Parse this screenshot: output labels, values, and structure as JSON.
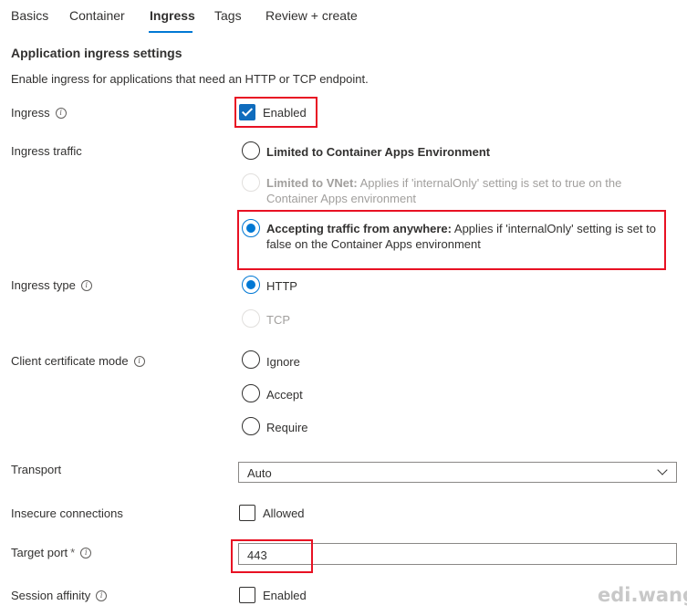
{
  "tabs": [
    {
      "label": "Basics"
    },
    {
      "label": "Container"
    },
    {
      "label": "Ingress"
    },
    {
      "label": "Tags"
    },
    {
      "label": "Review + create"
    }
  ],
  "section_title": "Application ingress settings",
  "description": "Enable ingress for applications that need an HTTP or TCP endpoint.",
  "ingress": {
    "label": "Ingress",
    "checkbox_label": "Enabled",
    "checked": true
  },
  "ingress_traffic": {
    "label": "Ingress traffic",
    "options": [
      {
        "title": "Limited to Container Apps Environment",
        "detail": "",
        "selected": false,
        "disabled": false
      },
      {
        "title": "Limited to VNet:",
        "detail_line1": "Applies if 'internalOnly' setting is set to true on the",
        "detail_line2": "Container Apps environment",
        "selected": false,
        "disabled": true
      },
      {
        "title": "Accepting traffic from anywhere:",
        "detail_line1": "Applies if 'internalOnly' setting is set to",
        "detail_line2": "false on the Container Apps environment",
        "selected": true,
        "disabled": false
      }
    ]
  },
  "ingress_type": {
    "label": "Ingress type",
    "options": [
      {
        "label": "HTTP",
        "selected": true,
        "disabled": false
      },
      {
        "label": "TCP",
        "selected": false,
        "disabled": true
      }
    ]
  },
  "client_certificate_mode": {
    "label": "Client certificate mode",
    "options": [
      {
        "label": "Ignore",
        "selected": false
      },
      {
        "label": "Accept",
        "selected": false
      },
      {
        "label": "Require",
        "selected": false
      }
    ]
  },
  "transport": {
    "label": "Transport",
    "value": "Auto"
  },
  "insecure_connections": {
    "label": "Insecure connections",
    "checkbox_label": "Allowed",
    "checked": false
  },
  "target_port": {
    "label": "Target port",
    "required_mark": "*",
    "value": "443"
  },
  "session_affinity": {
    "label": "Session affinity",
    "checkbox_label": "Enabled",
    "checked": false
  },
  "info_glyph": "i",
  "watermark": "edi.wang",
  "colors": {
    "accent": "#0078d4",
    "highlight_box": "#e81123",
    "text": "#323130",
    "disabled_text": "#a19f9d"
  }
}
